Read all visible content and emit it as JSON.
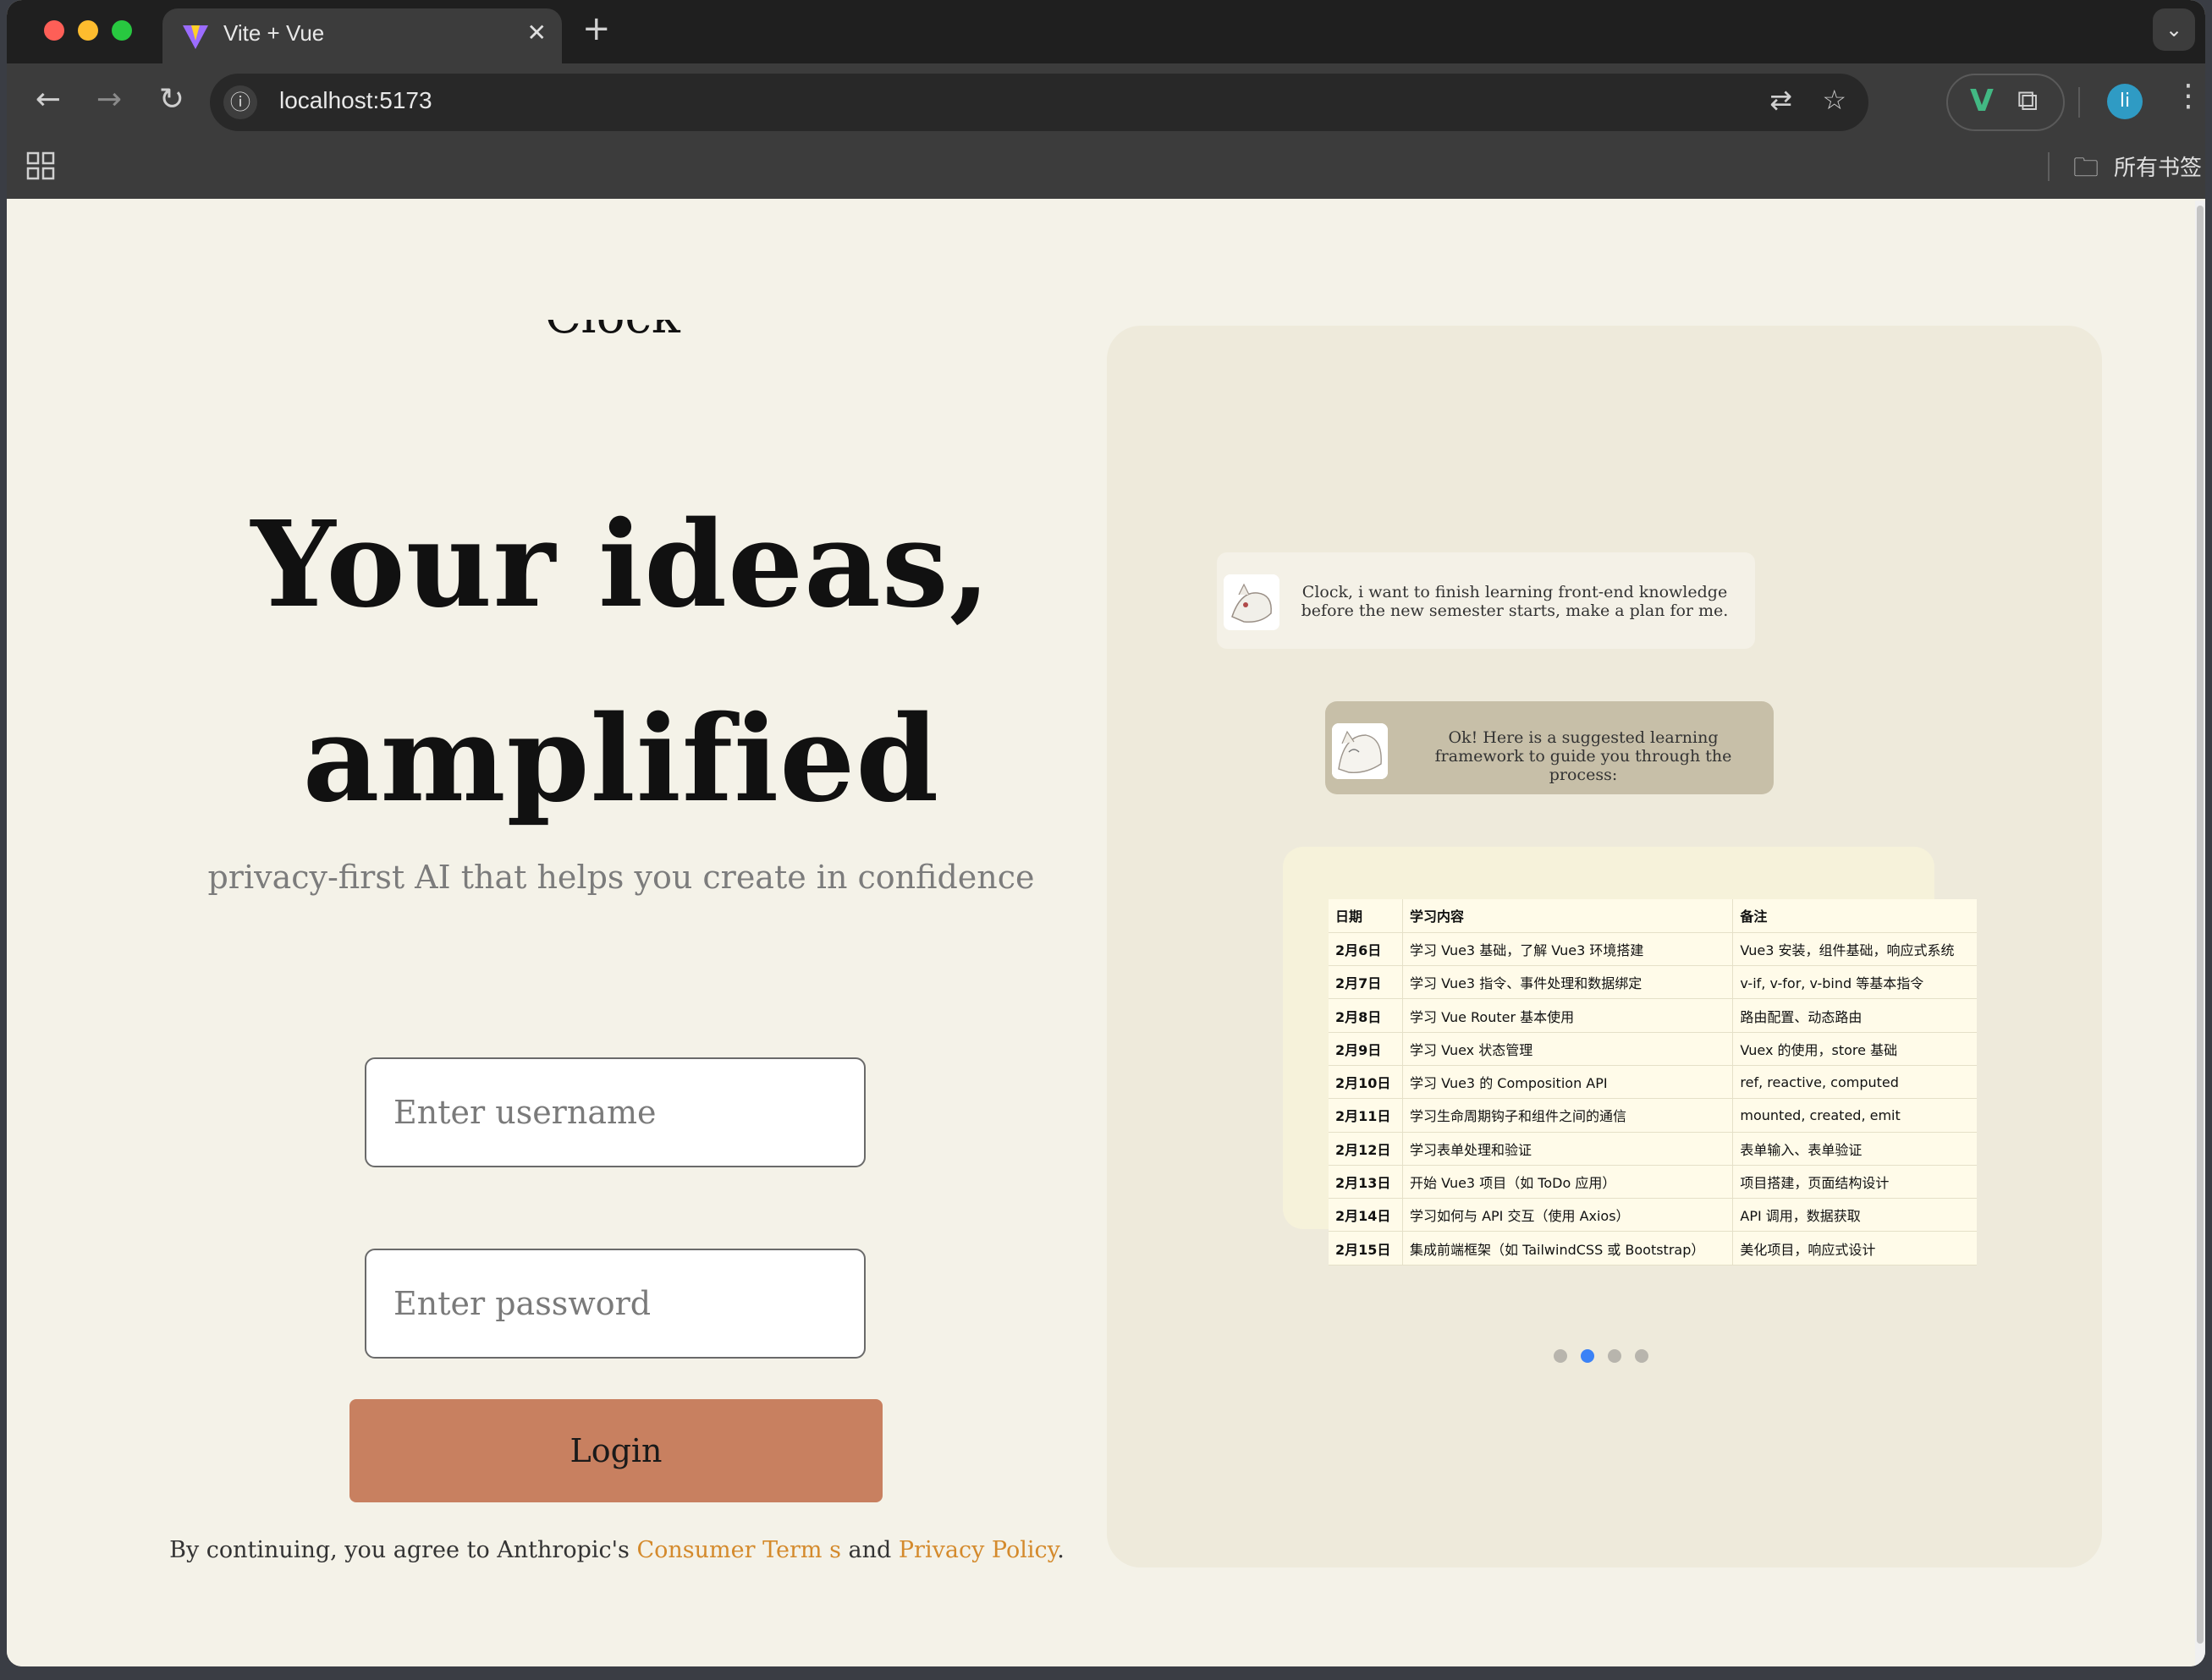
{
  "browser": {
    "tab_title": "Vite + Vue",
    "tab_close": "✕",
    "new_tab": "+",
    "url": "localhost:5173",
    "bookmarks_folder": "所有书签",
    "profile_initial": "li",
    "icons": {
      "back": "arrow-left-icon",
      "forward": "arrow-right-icon",
      "reload": "reload-icon",
      "site_info": "info-icon",
      "translate": "translate-icon",
      "star": "star-icon",
      "vue_devtools": "vue-icon",
      "extensions": "puzzle-icon",
      "menu": "more-vertical-icon",
      "apps": "apps-grid-icon",
      "folder": "folder-icon",
      "tab_search": "chevron-down-icon"
    }
  },
  "page": {
    "logo": "Clock",
    "headline_line1": "Your ideas,",
    "headline_line2": "amplified",
    "subtitle": "privacy-first AI that helps you create in confidence",
    "username_placeholder": "Enter username",
    "password_placeholder": "Enter password",
    "login_label": "Login",
    "legal_prefix": "By continuing, you agree to Anthropic's ",
    "legal_terms": "Consumer Term s",
    "legal_and": " and ",
    "legal_privacy": "Privacy Policy",
    "legal_suffix": ".",
    "colors": {
      "background": "#f4f2e8",
      "panel": "#eeeadb",
      "login_button": "#c88060",
      "link": "#d48a2c",
      "active_dot": "#3b82f6"
    }
  },
  "carousel": {
    "user_message": "Clock, i want to finish learning front-end knowledge before the new semester starts, make a plan for me.",
    "ai_message": "Ok! Here is a suggested learning framework to guide you through the process:",
    "table": {
      "headers": [
        "日期",
        "学习内容",
        "备注"
      ],
      "rows": [
        [
          "2月6日",
          "学习 Vue3 基础，了解 Vue3 环境搭建",
          "Vue3 安装，组件基础，响应式系统"
        ],
        [
          "2月7日",
          "学习 Vue3 指令、事件处理和数据绑定",
          "v-if, v-for, v-bind 等基本指令"
        ],
        [
          "2月8日",
          "学习 Vue Router 基本使用",
          "路由配置、动态路由"
        ],
        [
          "2月9日",
          "学习 Vuex 状态管理",
          "Vuex 的使用，store 基础"
        ],
        [
          "2月10日",
          "学习 Vue3 的 Composition API",
          "ref, reactive, computed"
        ],
        [
          "2月11日",
          "学习生命周期钩子和组件之间的通信",
          "mounted, created, emit"
        ],
        [
          "2月12日",
          "学习表单处理和验证",
          "表单输入、表单验证"
        ],
        [
          "2月13日",
          "开始 Vue3 项目（如 ToDo 应用）",
          "项目搭建，页面结构设计"
        ],
        [
          "2月14日",
          "学习如何与 API 交互（使用 Axios）",
          "API 调用，数据获取"
        ],
        [
          "2月15日",
          "集成前端框架（如 TailwindCSS 或 Bootstrap）",
          "美化项目，响应式设计"
        ]
      ]
    },
    "slide_count": 4,
    "active_slide": 2
  }
}
